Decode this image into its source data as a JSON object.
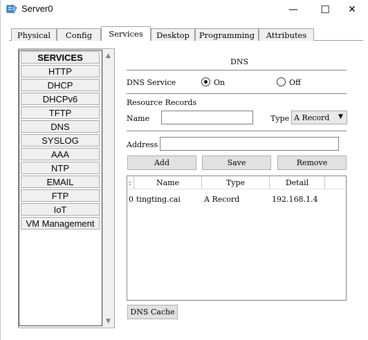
{
  "window": {
    "title": "Server0",
    "minimize": "—",
    "maximize": "☐",
    "close": "✕"
  },
  "tabs": [
    "Physical",
    "Config",
    "Services",
    "Desktop",
    "Programming",
    "Attributes"
  ],
  "sidebar": {
    "header": "SERVICES",
    "items": [
      "HTTP",
      "DHCP",
      "DHCPv6",
      "TFTP",
      "DNS",
      "SYSLOG",
      "AAA",
      "NTP",
      "EMAIL",
      "FTP",
      "IoT",
      "VM Management"
    ]
  },
  "dns": {
    "title": "DNS",
    "service_label": "DNS Service",
    "on_label": "On",
    "off_label": "Off",
    "service_state": "On",
    "records_label": "Resource Records",
    "name_label": "Name",
    "name_value": "",
    "type_label": "Type",
    "type_value": "A Record",
    "address_label": "Address",
    "address_value": "",
    "buttons": {
      "add": "Add",
      "save": "Save",
      "remove": "Remove"
    },
    "table": {
      "headers": [
        ":",
        "Name",
        "Type",
        "Detail"
      ],
      "rows": [
        {
          "index": "0",
          "name": "tingting.cai",
          "type": "A Record",
          "detail": "192.168.1.4"
        }
      ]
    },
    "cache_button": "DNS Cache"
  },
  "colors": {
    "window_bg": "#ffffff",
    "button_bg": "#e1e1e1",
    "tab_bg": "#f0f0f0",
    "border": "#a0a0a0"
  }
}
